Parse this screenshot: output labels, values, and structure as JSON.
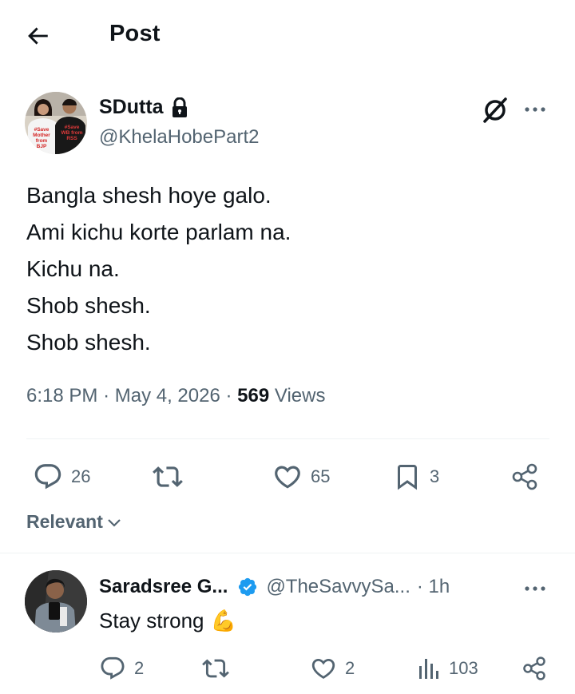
{
  "header": {
    "title": "Post"
  },
  "post": {
    "author_name": "SDutta",
    "author_handle": "@KhelaHobePart2",
    "avatar_shirt_left": "#Save\nMother\nfrom\nBJP",
    "avatar_shirt_right": "#Save\nWB from\nRSS",
    "lines": [
      "Bangla shesh hoye galo.",
      "Ami kichu korte parlam na.",
      "Kichu na.",
      "Shob shesh.",
      "Shob shesh."
    ],
    "time": "6:18 PM",
    "date": "May 4, 2026",
    "views_count": "569",
    "views_label": "Views",
    "replies": "26",
    "likes": "65",
    "bookmarks": "3"
  },
  "sort": {
    "label": "Relevant"
  },
  "reply": {
    "name": "Saradsree G...",
    "handle": "@TheSavvySa...",
    "time": "· 1h",
    "text": "Stay strong",
    "emoji": "💪",
    "replies": "2",
    "likes": "2",
    "views": "103"
  },
  "colors": {
    "text": "#0f1419",
    "muted": "#536471",
    "divider": "#eff3f4",
    "verified": "#1d9bf0"
  },
  "icons": [
    "back-arrow-icon",
    "lock-icon",
    "grok-icon",
    "more-icon",
    "reply-icon",
    "retweet-icon",
    "like-icon",
    "bookmark-icon",
    "share-icon",
    "chevron-down-icon",
    "verified-badge-icon",
    "views-icon"
  ]
}
